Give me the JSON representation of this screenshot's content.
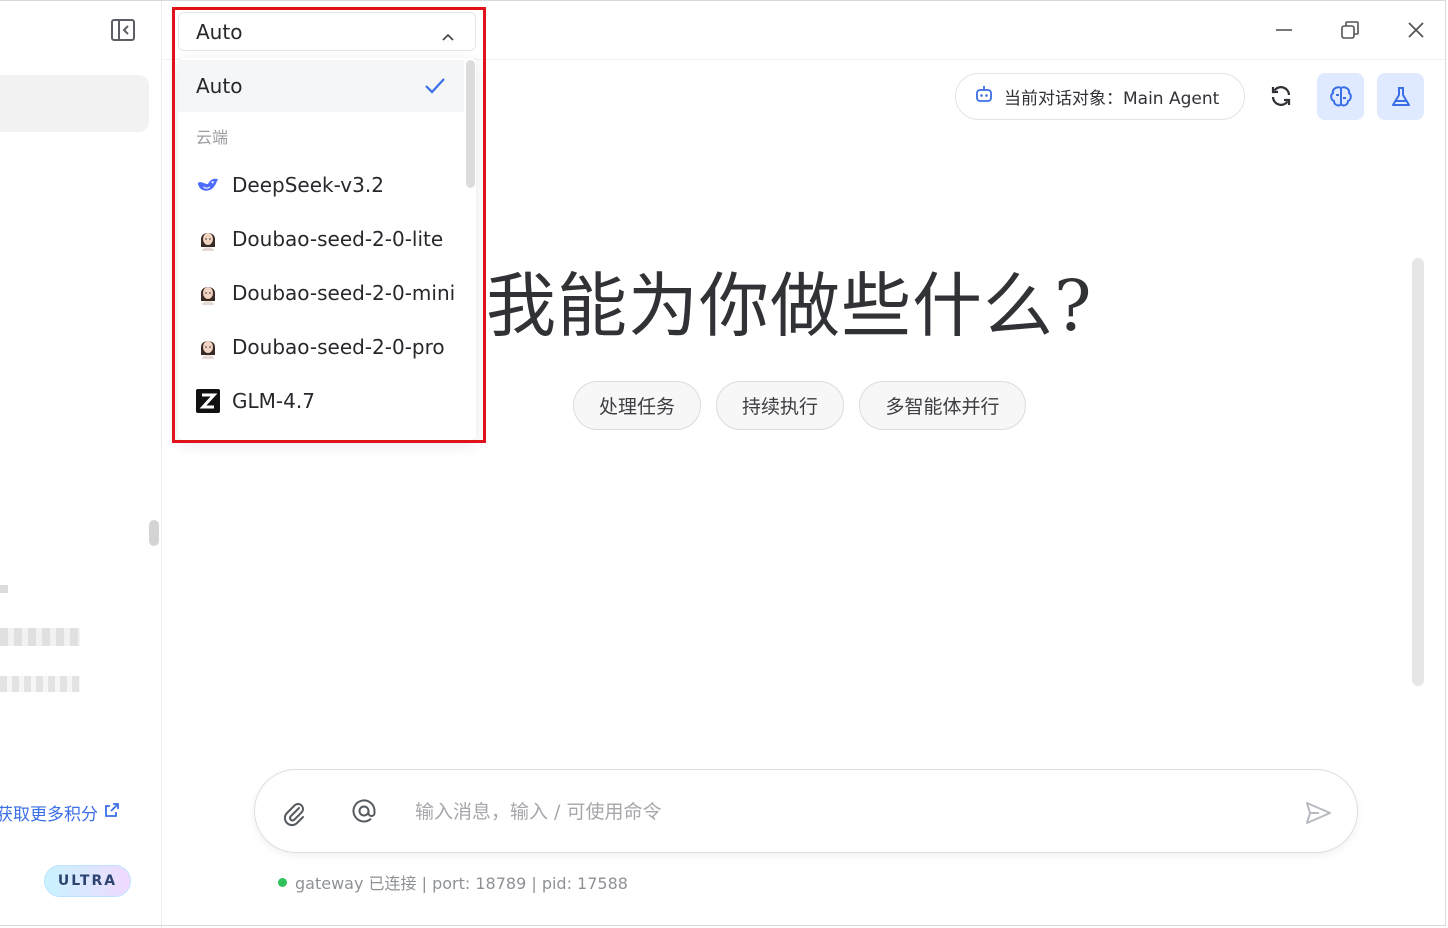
{
  "model_select": {
    "current": "Auto",
    "options": [
      {
        "label": "Auto",
        "selected": true,
        "icon": "check-icon"
      },
      {
        "label": "DeepSeek-v3.2",
        "icon": "deepseek-whale-icon"
      },
      {
        "label": "Doubao-seed-2-0-lite",
        "icon": "doubao-avatar-icon"
      },
      {
        "label": "Doubao-seed-2-0-mini",
        "icon": "doubao-avatar-icon"
      },
      {
        "label": "Doubao-seed-2-0-pro",
        "icon": "doubao-avatar-icon"
      },
      {
        "label": "GLM-4.7",
        "icon": "zhipu-z-icon"
      }
    ],
    "group_cloud": "云端"
  },
  "header": {
    "agent_label": "当前对话对象：Main Agent"
  },
  "hero": {
    "title": "我能为你做些什么?",
    "chips": [
      "处理任务",
      "持续执行",
      "多智能体并行"
    ]
  },
  "composer": {
    "placeholder": "输入消息，输入 / 可使用命令"
  },
  "status": {
    "text": "gateway 已连接 | port: 18789 | pid: 17588",
    "dot_color": "#2fc25b"
  },
  "sidebar": {
    "credits_link": "获取更多积分",
    "badge": "ULTRA"
  },
  "colors": {
    "accent": "#3b6fe6",
    "highlight": "#e0121a",
    "accent_bg": "#dfe9ff"
  }
}
